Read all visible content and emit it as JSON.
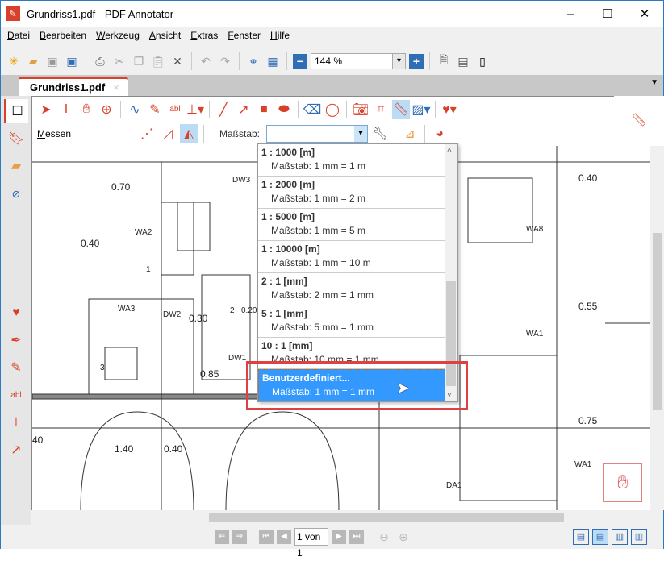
{
  "window": {
    "title": "Grundriss1.pdf - PDF Annotator",
    "min": "–",
    "max": "☐",
    "close": "✕"
  },
  "menu": [
    "Datei",
    "Bearbeiten",
    "Werkzeug",
    "Ansicht",
    "Extras",
    "Fenster",
    "Hilfe"
  ],
  "toolbar": {
    "zoom_value": "144 %"
  },
  "tab": {
    "label": "Grundriss1.pdf",
    "close": "×"
  },
  "measure": {
    "label": "Messen",
    "scale_label": "Maßstab:",
    "scale_value": ""
  },
  "dropdown": {
    "items": [
      {
        "title": "1 : 1000 [m]",
        "sub": "Maßstab: 1 mm = 1 m"
      },
      {
        "title": "1 : 2000 [m]",
        "sub": "Maßstab: 1 mm = 2 m"
      },
      {
        "title": "1 : 5000 [m]",
        "sub": "Maßstab: 1 mm = 5 m"
      },
      {
        "title": "1 : 10000 [m]",
        "sub": "Maßstab: 1 mm = 10 m"
      },
      {
        "title": "2 : 1 [mm]",
        "sub": "Maßstab: 2 mm = 1 mm"
      },
      {
        "title": "5 : 1 [mm]",
        "sub": "Maßstab: 5 mm = 1 mm"
      },
      {
        "title": "10 : 1 [mm]",
        "sub": "Maßstab: 10 mm = 1 mm"
      },
      {
        "title": "Benutzerdefiniert...",
        "sub": "Maßstab: 1 mm = 1 mm",
        "selected": true
      }
    ]
  },
  "plan_labels": [
    "0.70",
    "DW3",
    "WA2",
    "0.40",
    "WA3",
    "DW2",
    "0.30",
    "DW1",
    "0.85",
    "1.40",
    "0.40",
    "40",
    "WA8",
    "0.40",
    "0.55",
    "WA1",
    "0.75",
    "WA1",
    "DA1",
    "2",
    "0.20",
    "1",
    "3"
  ],
  "status": {
    "page": "1 von 1"
  },
  "colors": {
    "accent": "#d9402b",
    "highlight": "#3399ff",
    "callout": "#e04040"
  }
}
